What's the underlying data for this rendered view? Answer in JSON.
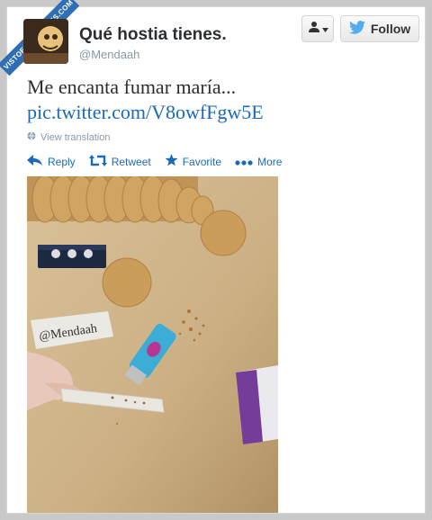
{
  "watermark": "VISTOENLASREDES.COM",
  "profile": {
    "display_name": "Qué hostia tienes.",
    "handle": "@Mendaah"
  },
  "buttons": {
    "follow_label": "Follow"
  },
  "tweet": {
    "text": "Me encanta fumar maría...",
    "link": "pic.twitter.com/V8owfFgw5E",
    "view_translation": "View translation"
  },
  "actions": {
    "reply": "Reply",
    "retweet": "Retweet",
    "favorite": "Favorite",
    "more": "More"
  },
  "photo": {
    "paper_label": "@Mendaah"
  },
  "colors": {
    "link_blue": "#1b6ab8",
    "twitter_blue": "#55acee",
    "wood": "#d9bf95"
  }
}
